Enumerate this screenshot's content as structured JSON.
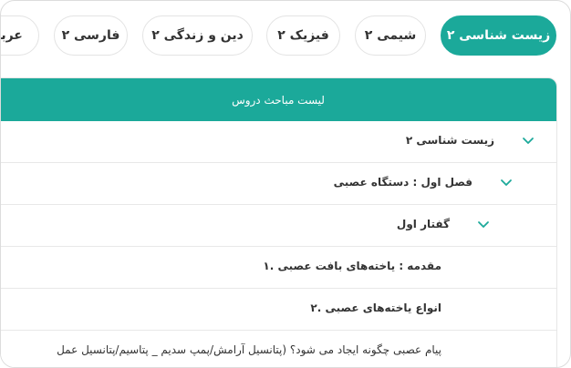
{
  "tabs": [
    {
      "label": "زیست شناسی ۲",
      "active": true
    },
    {
      "label": "شیمی ۲",
      "active": false
    },
    {
      "label": "فیزیک ۲",
      "active": false
    },
    {
      "label": "دین و زندگی ۲",
      "active": false
    },
    {
      "label": "فارسی ۲",
      "active": false
    },
    {
      "label": "عربی",
      "active": false
    }
  ],
  "panel": {
    "title": "لیست مباحث دروس",
    "rows": [
      {
        "label": "زیست شناسی ۲",
        "expanded": true
      },
      {
        "label": "فصل اول : دستگاه عصبی",
        "expanded": true
      },
      {
        "label": "گفتار اول",
        "expanded": true
      },
      {
        "label": "مقدمه : یاخته‌های بافت عصبی .۱"
      },
      {
        "label": "انواع یاخته‌های عصبی .۲"
      },
      {
        "label": "پیام عصبی چگونه ایجاد می شود؟ (پتانسیل آرامش/پمپ سدیم _ پتاسیم/پتانسیل عمل"
      }
    ]
  },
  "colors": {
    "accent": "#1ba99a"
  },
  "icons": {
    "expand": "chevron-down-icon"
  }
}
